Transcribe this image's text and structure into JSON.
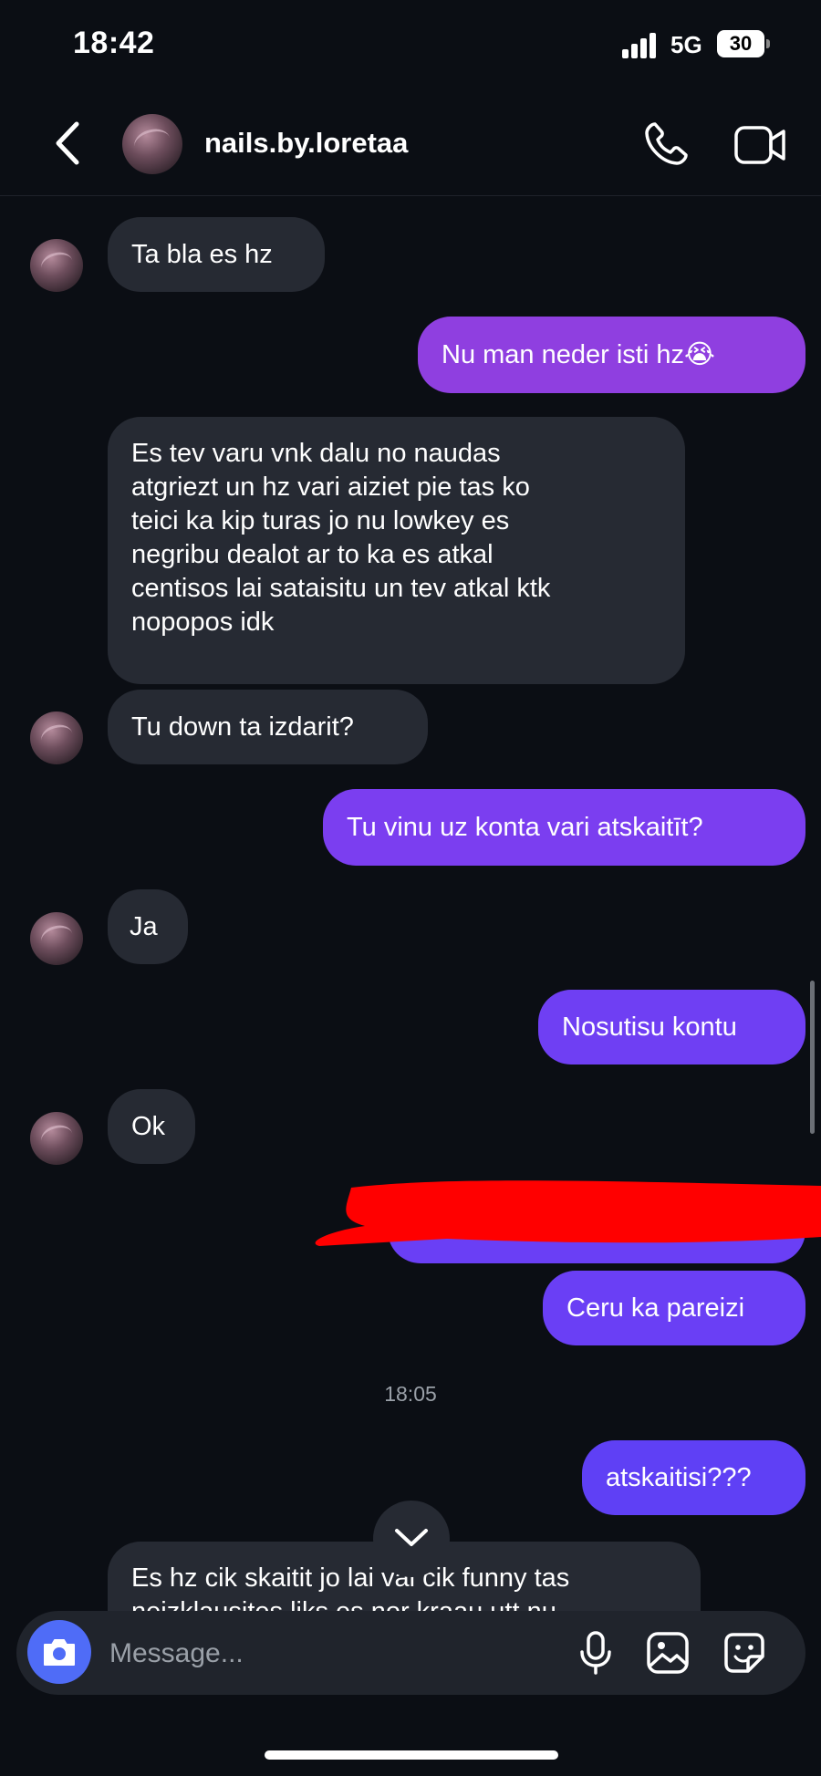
{
  "status": {
    "time": "18:42",
    "network": "5G",
    "battery": "30"
  },
  "header": {
    "username": "nails.by.loretaa"
  },
  "messages": [
    {
      "text": "Ta bla es hz"
    },
    {
      "text": "Nu man neder isti hz😭"
    },
    {
      "lines": [
        "Es tev varu vnk dalu no naudas",
        "atgriezt un hz vari aiziet pie tas ko",
        "teici ka kip turas jo nu lowkey es",
        "negribu dealot ar to ka es atkal",
        "centisos lai sataisitu un tev atkal ktk",
        "nopopos idk"
      ]
    },
    {
      "text": "Tu down ta izdarit?"
    },
    {
      "text": "Tu vinu uz konta vari atskaitīt?"
    },
    {
      "text": "Ja"
    },
    {
      "text": "Nosutisu kontu"
    },
    {
      "text": "Ok"
    },
    {
      "text": "Ceru ka pareizi"
    },
    {
      "text": "atskaitisi???"
    },
    {
      "lines": [
        "Es hz cik skaitit jo lai vai cik funny tas",
        "neizklausites liks es nor kraau utt nu"
      ]
    }
  ],
  "timestamp": "18:05",
  "composer": {
    "placeholder": "Message..."
  },
  "colors": {
    "background": "#0b0e14",
    "incoming": "#262a33",
    "outgoing_purple": "#8f3fe0",
    "outgoing_indigo": "#6a3ff5",
    "redaction": "#ff0000",
    "camera": "#4f6cf7"
  },
  "icons": [
    "back-chevron-icon",
    "phone-icon",
    "video-camera-icon",
    "chevron-down-icon",
    "camera-icon",
    "microphone-icon",
    "gallery-icon",
    "sticker-icon"
  ]
}
